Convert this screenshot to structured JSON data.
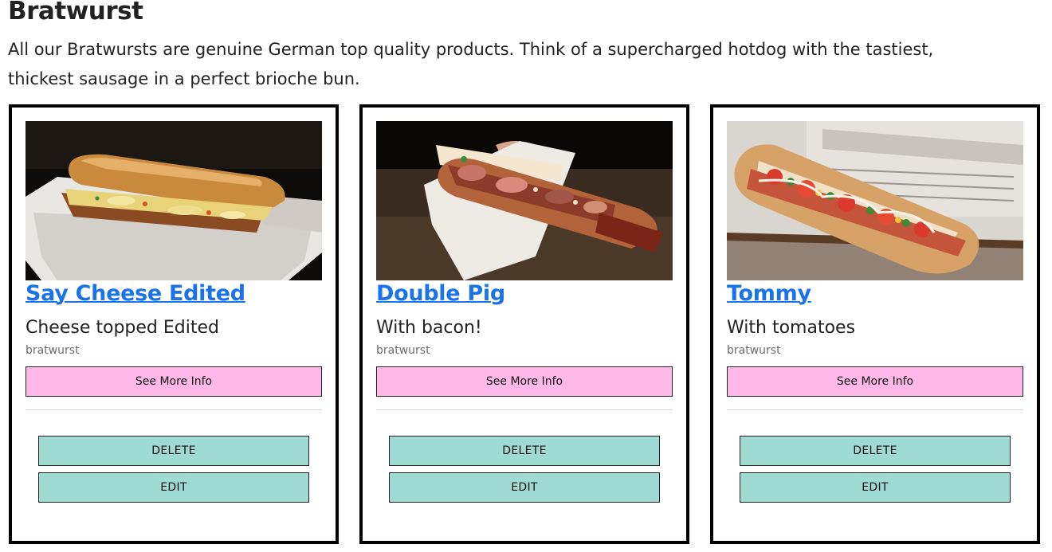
{
  "section": {
    "title": "Bratwurst",
    "intro": "All our Bratwursts are genuine German top quality products. Think of a supercharged hotdog with the tastiest, thickest sausage in a perfect brioche bun."
  },
  "products": [
    {
      "name": "Say Cheese Edited",
      "description": "Cheese topped Edited",
      "category": "bratwurst",
      "image_icon": "hotdog-cheese-photo",
      "more_label": "See More Info",
      "delete_label": "DELETE",
      "edit_label": "EDIT"
    },
    {
      "name": "Double Pig",
      "description": "With bacon!",
      "category": "bratwurst",
      "image_icon": "hotdog-bacon-photo",
      "more_label": "See More Info",
      "delete_label": "DELETE",
      "edit_label": "EDIT"
    },
    {
      "name": "Tommy",
      "description": "With tomatoes",
      "category": "bratwurst",
      "image_icon": "hotdog-tomato-photo",
      "more_label": "See More Info",
      "delete_label": "DELETE",
      "edit_label": "EDIT"
    }
  ],
  "colors": {
    "link": "#1a73e8",
    "more_button_bg": "#ffb8e8",
    "action_button_bg": "#9fdad3",
    "card_border": "#000000"
  }
}
